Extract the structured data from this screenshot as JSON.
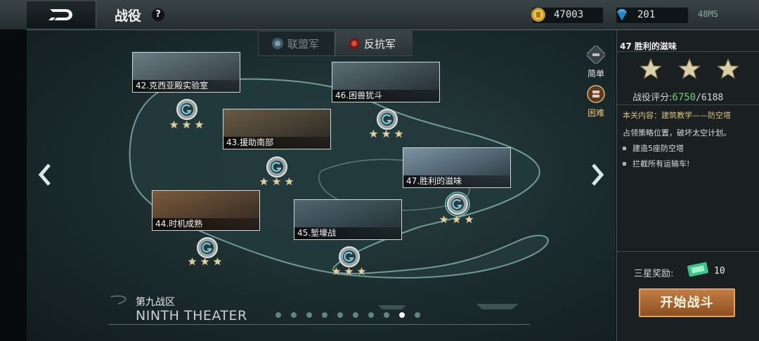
{
  "header": {
    "title": "战役",
    "help_label": "?",
    "gold": "47003",
    "diamonds": "201",
    "status": "48MS"
  },
  "factions": {
    "allies": "联盟军",
    "resistance": "反抗军",
    "selected": "resistance"
  },
  "difficulty": {
    "easy": "简单",
    "hard": "困难",
    "selected": "hard"
  },
  "stages": [
    {
      "label": "42.克西亚殿实验室",
      "stars": 3
    },
    {
      "label": "43.援助南部",
      "stars": 3
    },
    {
      "label": "44.时机成熟",
      "stars": 3
    },
    {
      "label": "45.堑壕战",
      "stars": 3
    },
    {
      "label": "46.困兽犹斗",
      "stars": 3
    },
    {
      "label": "47.胜利的滋味",
      "stars": 3
    }
  ],
  "theater": {
    "name_cn": "第九战区",
    "name_en": "NINTH THEATER",
    "page_count": 10,
    "current_page": 9
  },
  "panel": {
    "stage_title": "47 胜利的滋味",
    "stars": 3,
    "score_label": "战役评分:",
    "score": "6750",
    "score_total": "/6188",
    "content_line": "本关内容：建筑教学——防空塔",
    "description": "占领策略位置，破坏太空计划。",
    "objectives": [
      "建造5座防空塔",
      "拦截所有运输车!"
    ],
    "reward_label": "三星奖励:",
    "reward_count": "10",
    "start_button": "开始战斗"
  },
  "colors": {
    "accent_green": "#6fcf7b",
    "content_gold": "#d9c27c",
    "button_bronze": "#a8642e"
  }
}
